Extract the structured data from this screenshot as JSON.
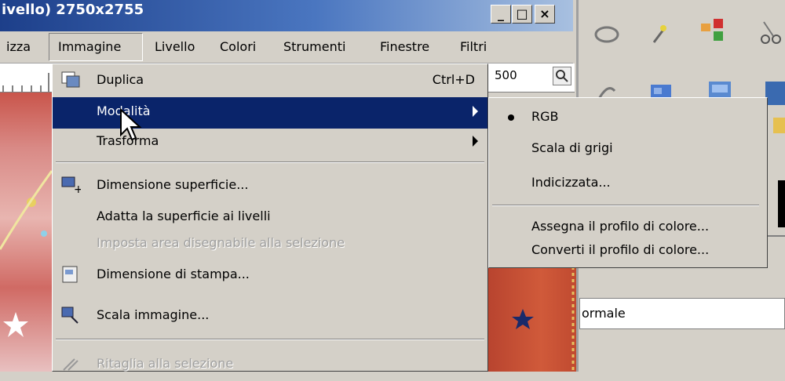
{
  "window": {
    "title": "ivello) 2750x2755",
    "minimize_glyph": "_",
    "maximize_glyph": "□",
    "close_glyph": "×"
  },
  "menubar": {
    "items": [
      {
        "label": "izza"
      },
      {
        "label": "Immagine",
        "mnemonic": "I"
      },
      {
        "label": "Livello",
        "mnemonic": "L"
      },
      {
        "label": "Colori",
        "mnemonic": "C"
      },
      {
        "label": "Strumenti",
        "mnemonic": "t"
      },
      {
        "label": "Finestre",
        "mnemonic": "F"
      },
      {
        "label": "Filtri",
        "mnemonic": "r"
      }
    ]
  },
  "ruler_right_text": "500",
  "menu": {
    "items": [
      {
        "label": "Duplica",
        "shortcut": "Ctrl+D",
        "icon": "duplicate-icon"
      },
      {
        "label": "Modalità",
        "submenu": true,
        "selected": true
      },
      {
        "label": "Trasforma",
        "submenu": true
      },
      {
        "label": "Dimensione superficie...",
        "icon": "canvas-size-icon"
      },
      {
        "label": "Adatta la superficie ai livelli"
      },
      {
        "label": "Imposta area disegnabile alla selezione",
        "disabled": true
      },
      {
        "label": "Dimensione di stampa...",
        "icon": "print-size-icon"
      },
      {
        "label": "Scala immagine...",
        "icon": "scale-image-icon"
      },
      {
        "label": "Ritaglia alla selezione",
        "disabled": true,
        "icon": "crop-icon"
      }
    ]
  },
  "submenu": {
    "items": [
      {
        "label": "RGB",
        "checked": true
      },
      {
        "label": "Scala di grigi"
      },
      {
        "label": "Indicizzata..."
      },
      {
        "label": "Assegna il profilo di colore..."
      },
      {
        "label": "Converti il profilo di colore..."
      }
    ]
  },
  "toolbox": {
    "tools": [
      "lasso-icon",
      "fuzzy-select-icon",
      "select-by-color-icon",
      "scissors-icon",
      "paths-icon",
      "color-picker-icon",
      "zoom-icon",
      "measure-icon"
    ],
    "mode_field_text": "ormale"
  },
  "colors": {
    "selection": "#0a246a",
    "face": "#d4d0c8",
    "disabled": "#a0a0a0"
  }
}
